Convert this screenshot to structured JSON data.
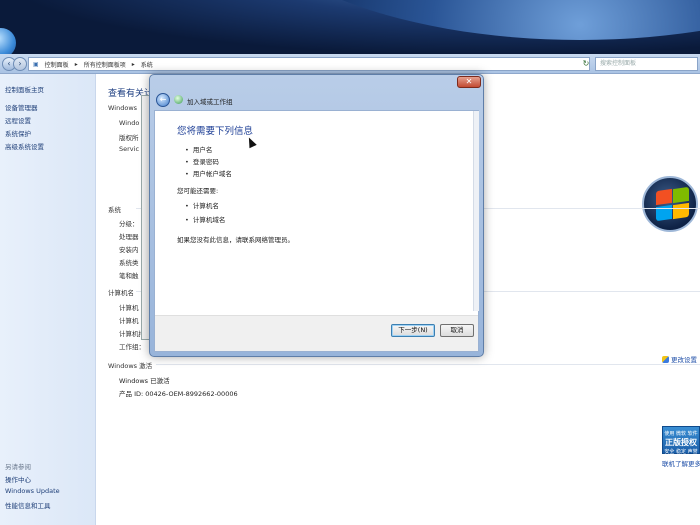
{
  "address_bar": {
    "crumbs": [
      "控制面板",
      "所有控制面板项",
      "系统"
    ],
    "search_placeholder": "搜索控制面板"
  },
  "sidebar": {
    "home": "控制面板主页",
    "items": [
      "设备管理器",
      "远程设置",
      "系统保护",
      "高级系统设置"
    ],
    "see_also": "另请参阅",
    "links": [
      "操作中心",
      "Windows Update",
      "性能信息和工具"
    ]
  },
  "main": {
    "title": "查看有关计",
    "edition_section": "Windows",
    "edition_rows": [
      "Windo",
      "版权所",
      "Servic"
    ],
    "system_section": "系统",
    "system_rows": [
      "分级：",
      "处理器",
      "安装内",
      "系统类",
      "笔和触"
    ],
    "computer_section": "计算机名",
    "computer_rows": [
      "计算机",
      "计算机",
      "计算机描",
      "工作组："
    ],
    "change_settings": "更改设置",
    "activation_section": "Windows 激活",
    "activation_status": "Windows 已激活",
    "product_id": "产品 ID: 00426-OEM-8992662-00006",
    "genuine_badge_top": "使用 微软 软件",
    "genuine_badge_main": "正版授权",
    "genuine_badge_bottom": "安全 稳定 声誉",
    "more_info": "联机了解更多"
  },
  "wizard": {
    "title": "加入域或工作组",
    "heading": "您将需要下列信息",
    "need_items": [
      "用户名",
      "登录密码",
      "用户帐户域名"
    ],
    "also_label": "您可能还需要:",
    "also_items": [
      "计算机名",
      "计算机域名"
    ],
    "contact_text": "如果您没有此信息，请联系网络管理员。",
    "next_button": "下一步(N)",
    "cancel_button": "取消",
    "close_glyph": "✕"
  }
}
